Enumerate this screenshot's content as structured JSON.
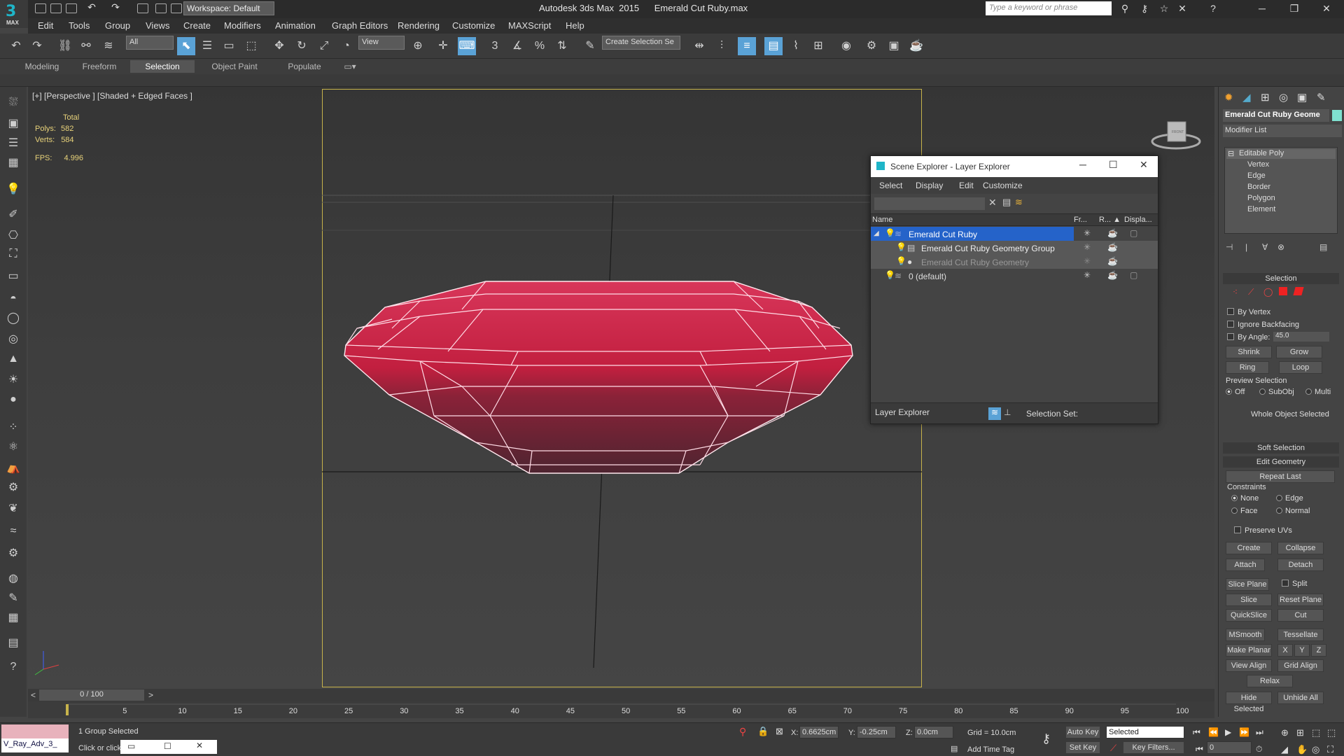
{
  "titlebar": {
    "logo_letter": "3",
    "logo_text": "MAX",
    "workspace": "Workspace: Default",
    "app_title": "Autodesk 3ds Max  2015      Emerald Cut Ruby.max",
    "search_placeholder": "Type a keyword or phrase"
  },
  "menubar": [
    "Edit",
    "Tools",
    "Group",
    "Views",
    "Create",
    "Modifiers",
    "Animation",
    "Graph Editors",
    "Rendering",
    "Customize",
    "MAXScript",
    "Help"
  ],
  "toolbar": {
    "selection_filter": "All",
    "ref_coord": "View",
    "named_selection": "Create Selection Se",
    "snap_label": "3"
  },
  "ribbon_tabs": [
    {
      "label": "Modeling",
      "selected": false
    },
    {
      "label": "Freeform",
      "selected": false
    },
    {
      "label": "Selection",
      "selected": true
    },
    {
      "label": "Object Paint",
      "selected": false
    },
    {
      "label": "Populate",
      "selected": false
    }
  ],
  "viewport": {
    "label": "[+] [Perspective ] [Shaded + Edged Faces ]",
    "stats": {
      "total_label": "Total",
      "polys_label": "Polys:",
      "polys": "582",
      "verts_label": "Verts:",
      "verts": "584",
      "fps_label": "FPS:",
      "fps": "4.996"
    },
    "viewcube_label": "FRONT"
  },
  "scene_explorer": {
    "title": "Scene Explorer - Layer Explorer",
    "menu": [
      "Select",
      "Display",
      "Edit",
      "Customize"
    ],
    "columns": [
      "Name",
      "Fr...",
      "R... ▲",
      "Displa..."
    ],
    "rows": [
      {
        "label": "Emerald Cut Ruby",
        "indent": 0,
        "state": "selected"
      },
      {
        "label": "Emerald Cut Ruby Geometry Group",
        "indent": 1,
        "state": "highlight"
      },
      {
        "label": "Emerald Cut Ruby Geometry",
        "indent": 1,
        "state": "dim"
      },
      {
        "label": "0 (default)",
        "indent": 0,
        "state": "normal"
      }
    ],
    "footer_mode": "Layer Explorer",
    "selection_set_label": "Selection Set:"
  },
  "command_panel": {
    "object_name": "Emerald Cut Ruby Geome",
    "modifier_list": "Modifier List",
    "stack": [
      "Editable Poly",
      "Vertex",
      "Edge",
      "Border",
      "Polygon",
      "Element"
    ],
    "selection": {
      "header": "Selection",
      "by_vertex": "By Vertex",
      "ignore_backfacing": "Ignore Backfacing",
      "by_angle": "By Angle:",
      "angle_value": "45.0",
      "shrink": "Shrink",
      "grow": "Grow",
      "ring": "Ring",
      "loop": "Loop",
      "preview_selection": "Preview Selection",
      "preview_off": "Off",
      "preview_subobj": "SubObj",
      "preview_multi": "Multi",
      "whole_object": "Whole Object Selected"
    },
    "soft_selection": "Soft Selection",
    "edit_geometry": {
      "header": "Edit Geometry",
      "repeat_last": "Repeat Last",
      "constraints": "Constraints",
      "none": "None",
      "edge": "Edge",
      "face": "Face",
      "normal": "Normal",
      "preserve_uvs": "Preserve UVs",
      "create": "Create",
      "collapse": "Collapse",
      "attach": "Attach",
      "detach": "Detach",
      "slice_plane": "Slice Plane",
      "split": "Split",
      "slice": "Slice",
      "reset_plane": "Reset Plane",
      "quickslice": "QuickSlice",
      "cut": "Cut",
      "msmooth": "MSmooth",
      "tessellate": "Tessellate",
      "make_planar": "Make Planar",
      "x": "X",
      "y": "Y",
      "z": "Z",
      "view_align": "View Align",
      "grid_align": "Grid Align",
      "relax": "Relax",
      "hide_selected": "Hide Selected",
      "unhide_all": "Unhide All"
    }
  },
  "timeline": {
    "frame_display": "0 / 100",
    "ticks": [
      "5",
      "10",
      "15",
      "20",
      "25",
      "30",
      "35",
      "40",
      "45",
      "50",
      "55",
      "60",
      "65",
      "70",
      "75",
      "80",
      "85",
      "90",
      "95",
      "100"
    ]
  },
  "status": {
    "script_listener": "V_Ray_Adv_3_",
    "selected_text": "1 Group Selected",
    "prompt": "Click or click",
    "x_label": "X:",
    "x_value": "0.6625cm",
    "y_label": "Y:",
    "y_value": "-0.25cm",
    "z_label": "Z:",
    "z_value": "0.0cm",
    "grid": "Grid = 10.0cm",
    "add_time_tag": "Add Time Tag",
    "auto_key": "Auto Key",
    "set_key": "Set Key",
    "selected_dropdown": "Selected",
    "key_filters": "Key Filters...",
    "frame_value": "0"
  },
  "colors": {
    "accent": "#5aa2d6",
    "safe_frame": "#c7b34b",
    "ruby": "#c42040",
    "selected_row": "#2563c9"
  }
}
